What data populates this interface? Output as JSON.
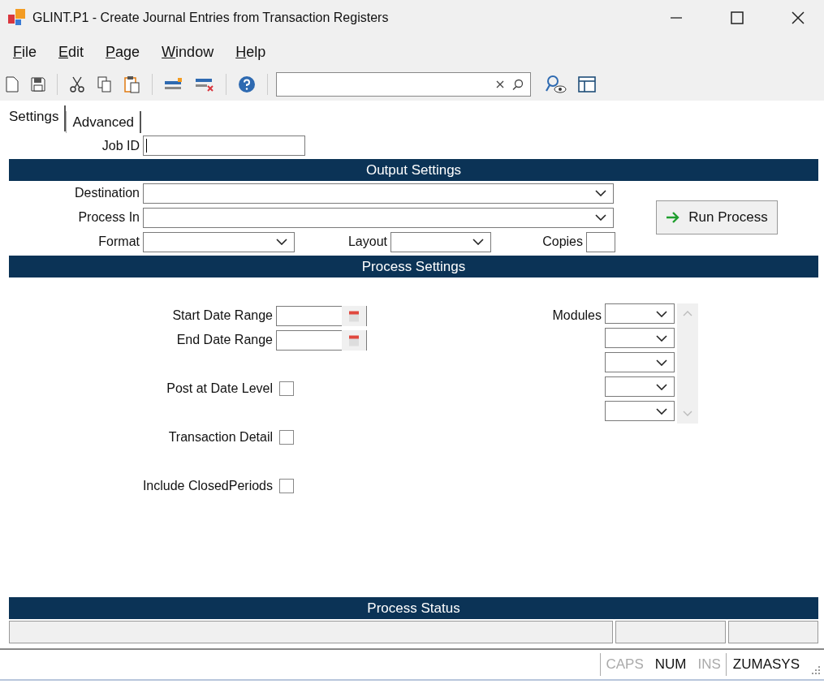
{
  "window": {
    "title": "GLINT.P1 - Create Journal Entries from Transaction Registers"
  },
  "menu": [
    {
      "label": "File"
    },
    {
      "label": "Edit"
    },
    {
      "label": "Page"
    },
    {
      "label": "Window"
    },
    {
      "label": "Help"
    }
  ],
  "tabs": [
    {
      "label": "Settings",
      "selected": true
    },
    {
      "label": "Advanced",
      "selected": false
    }
  ],
  "job_id": {
    "label": "Job ID"
  },
  "output_settings": {
    "title": "Output Settings",
    "destination": {
      "label": "Destination"
    },
    "process_in": {
      "label": "Process In"
    },
    "format": {
      "label": "Format"
    },
    "layout": {
      "label": "Layout"
    },
    "copies": {
      "label": "Copies"
    },
    "run_button": "Run Process"
  },
  "process_settings": {
    "title": "Process Settings",
    "start_date": {
      "label": "Start Date Range"
    },
    "end_date": {
      "label": "End Date Range"
    },
    "options": [
      {
        "label": "Post at Date Level",
        "checked": false
      },
      {
        "label": "Transaction Detail",
        "checked": false
      },
      {
        "label": "Include ClosedPeriods",
        "checked": false
      }
    ],
    "modules": {
      "label": "Modules"
    }
  },
  "process_status": {
    "title": "Process Status"
  },
  "status_bar": {
    "indicators": [
      {
        "label": "CAPS",
        "on": false
      },
      {
        "label": "NUM",
        "on": true
      },
      {
        "label": "INS",
        "on": false
      }
    ],
    "user": "ZUMASYS"
  }
}
